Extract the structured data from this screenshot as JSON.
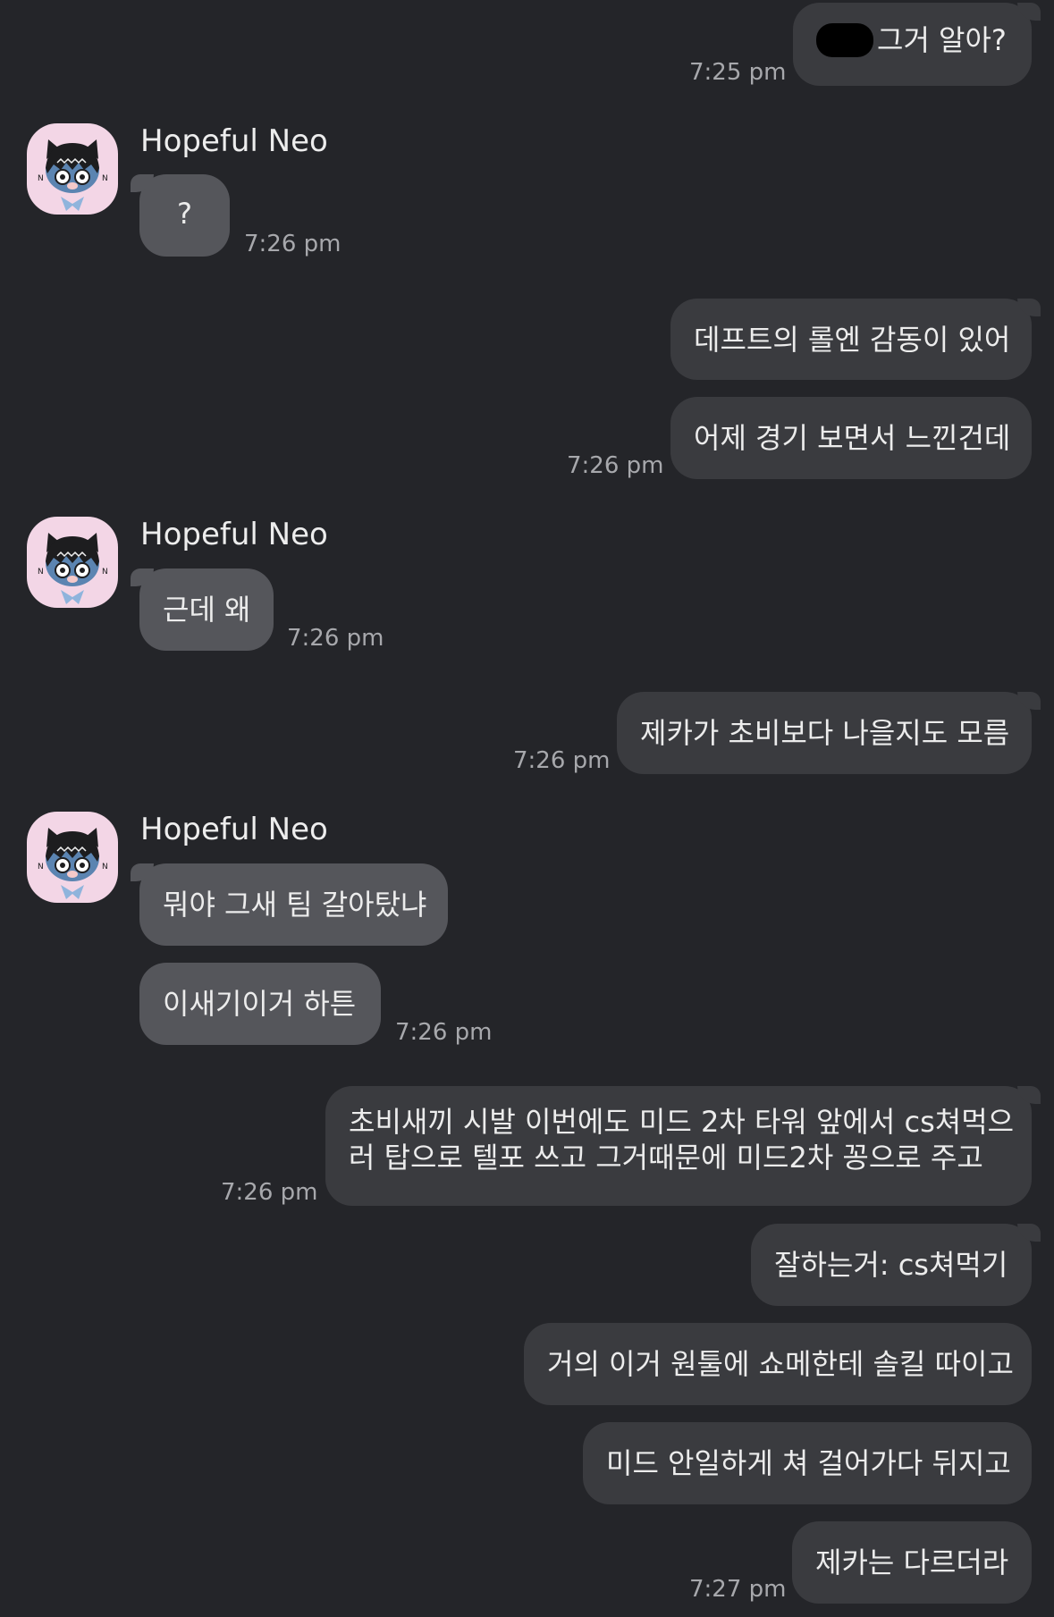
{
  "contact": {
    "name": "Hopeful Neo",
    "avatar_icon": "neo-character-avatar-icon"
  },
  "messages": [
    {
      "id": 1,
      "direction": "outgoing",
      "text": "그거 알아?",
      "has_redaction": true,
      "time": "7:25 pm"
    },
    {
      "id": 2,
      "direction": "incoming",
      "text": "?",
      "time": "7:26 pm"
    },
    {
      "id": 3,
      "direction": "outgoing",
      "text": "데프트의 롤엔 감동이 있어"
    },
    {
      "id": 4,
      "direction": "outgoing",
      "text": "어제 경기 보면서 느낀건데",
      "time": "7:26 pm"
    },
    {
      "id": 5,
      "direction": "incoming",
      "text": "근데 왜",
      "time": "7:26 pm"
    },
    {
      "id": 6,
      "direction": "outgoing",
      "text": "제카가 초비보다 나을지도 모름",
      "time": "7:26 pm"
    },
    {
      "id": 7,
      "direction": "incoming",
      "text": "뭐야 그새 팀 갈아탔냐"
    },
    {
      "id": 8,
      "direction": "incoming",
      "text": "이새기이거 하튼",
      "time": "7:26 pm"
    },
    {
      "id": 9,
      "direction": "outgoing",
      "lines": [
        "초비새끼 시발 이번에도 미드 2차 타워 앞에서 cs쳐먹으",
        "러 탑으로 텔포 쓰고 그거때문에 미드2차 꽁으로 주고"
      ],
      "time": "7:26 pm"
    },
    {
      "id": 10,
      "direction": "outgoing",
      "text": "잘하는거: cs쳐먹기"
    },
    {
      "id": 11,
      "direction": "outgoing",
      "text": "거의 이거 원툴에 쇼메한테 솔킬 따이고"
    },
    {
      "id": 12,
      "direction": "outgoing",
      "text": "미드 안일하게 쳐 걸어가다 뒤지고"
    },
    {
      "id": 13,
      "direction": "outgoing",
      "text": "제카는 다르더라",
      "time": "7:27 pm"
    }
  ],
  "colors": {
    "background": "#242529",
    "outgoing_bubble": "#3A3B3F",
    "incoming_bubble": "#55565B",
    "text": "#ECECEC",
    "timestamp": "#A7A8AC",
    "avatar_bg": "#F3D6E6"
  }
}
